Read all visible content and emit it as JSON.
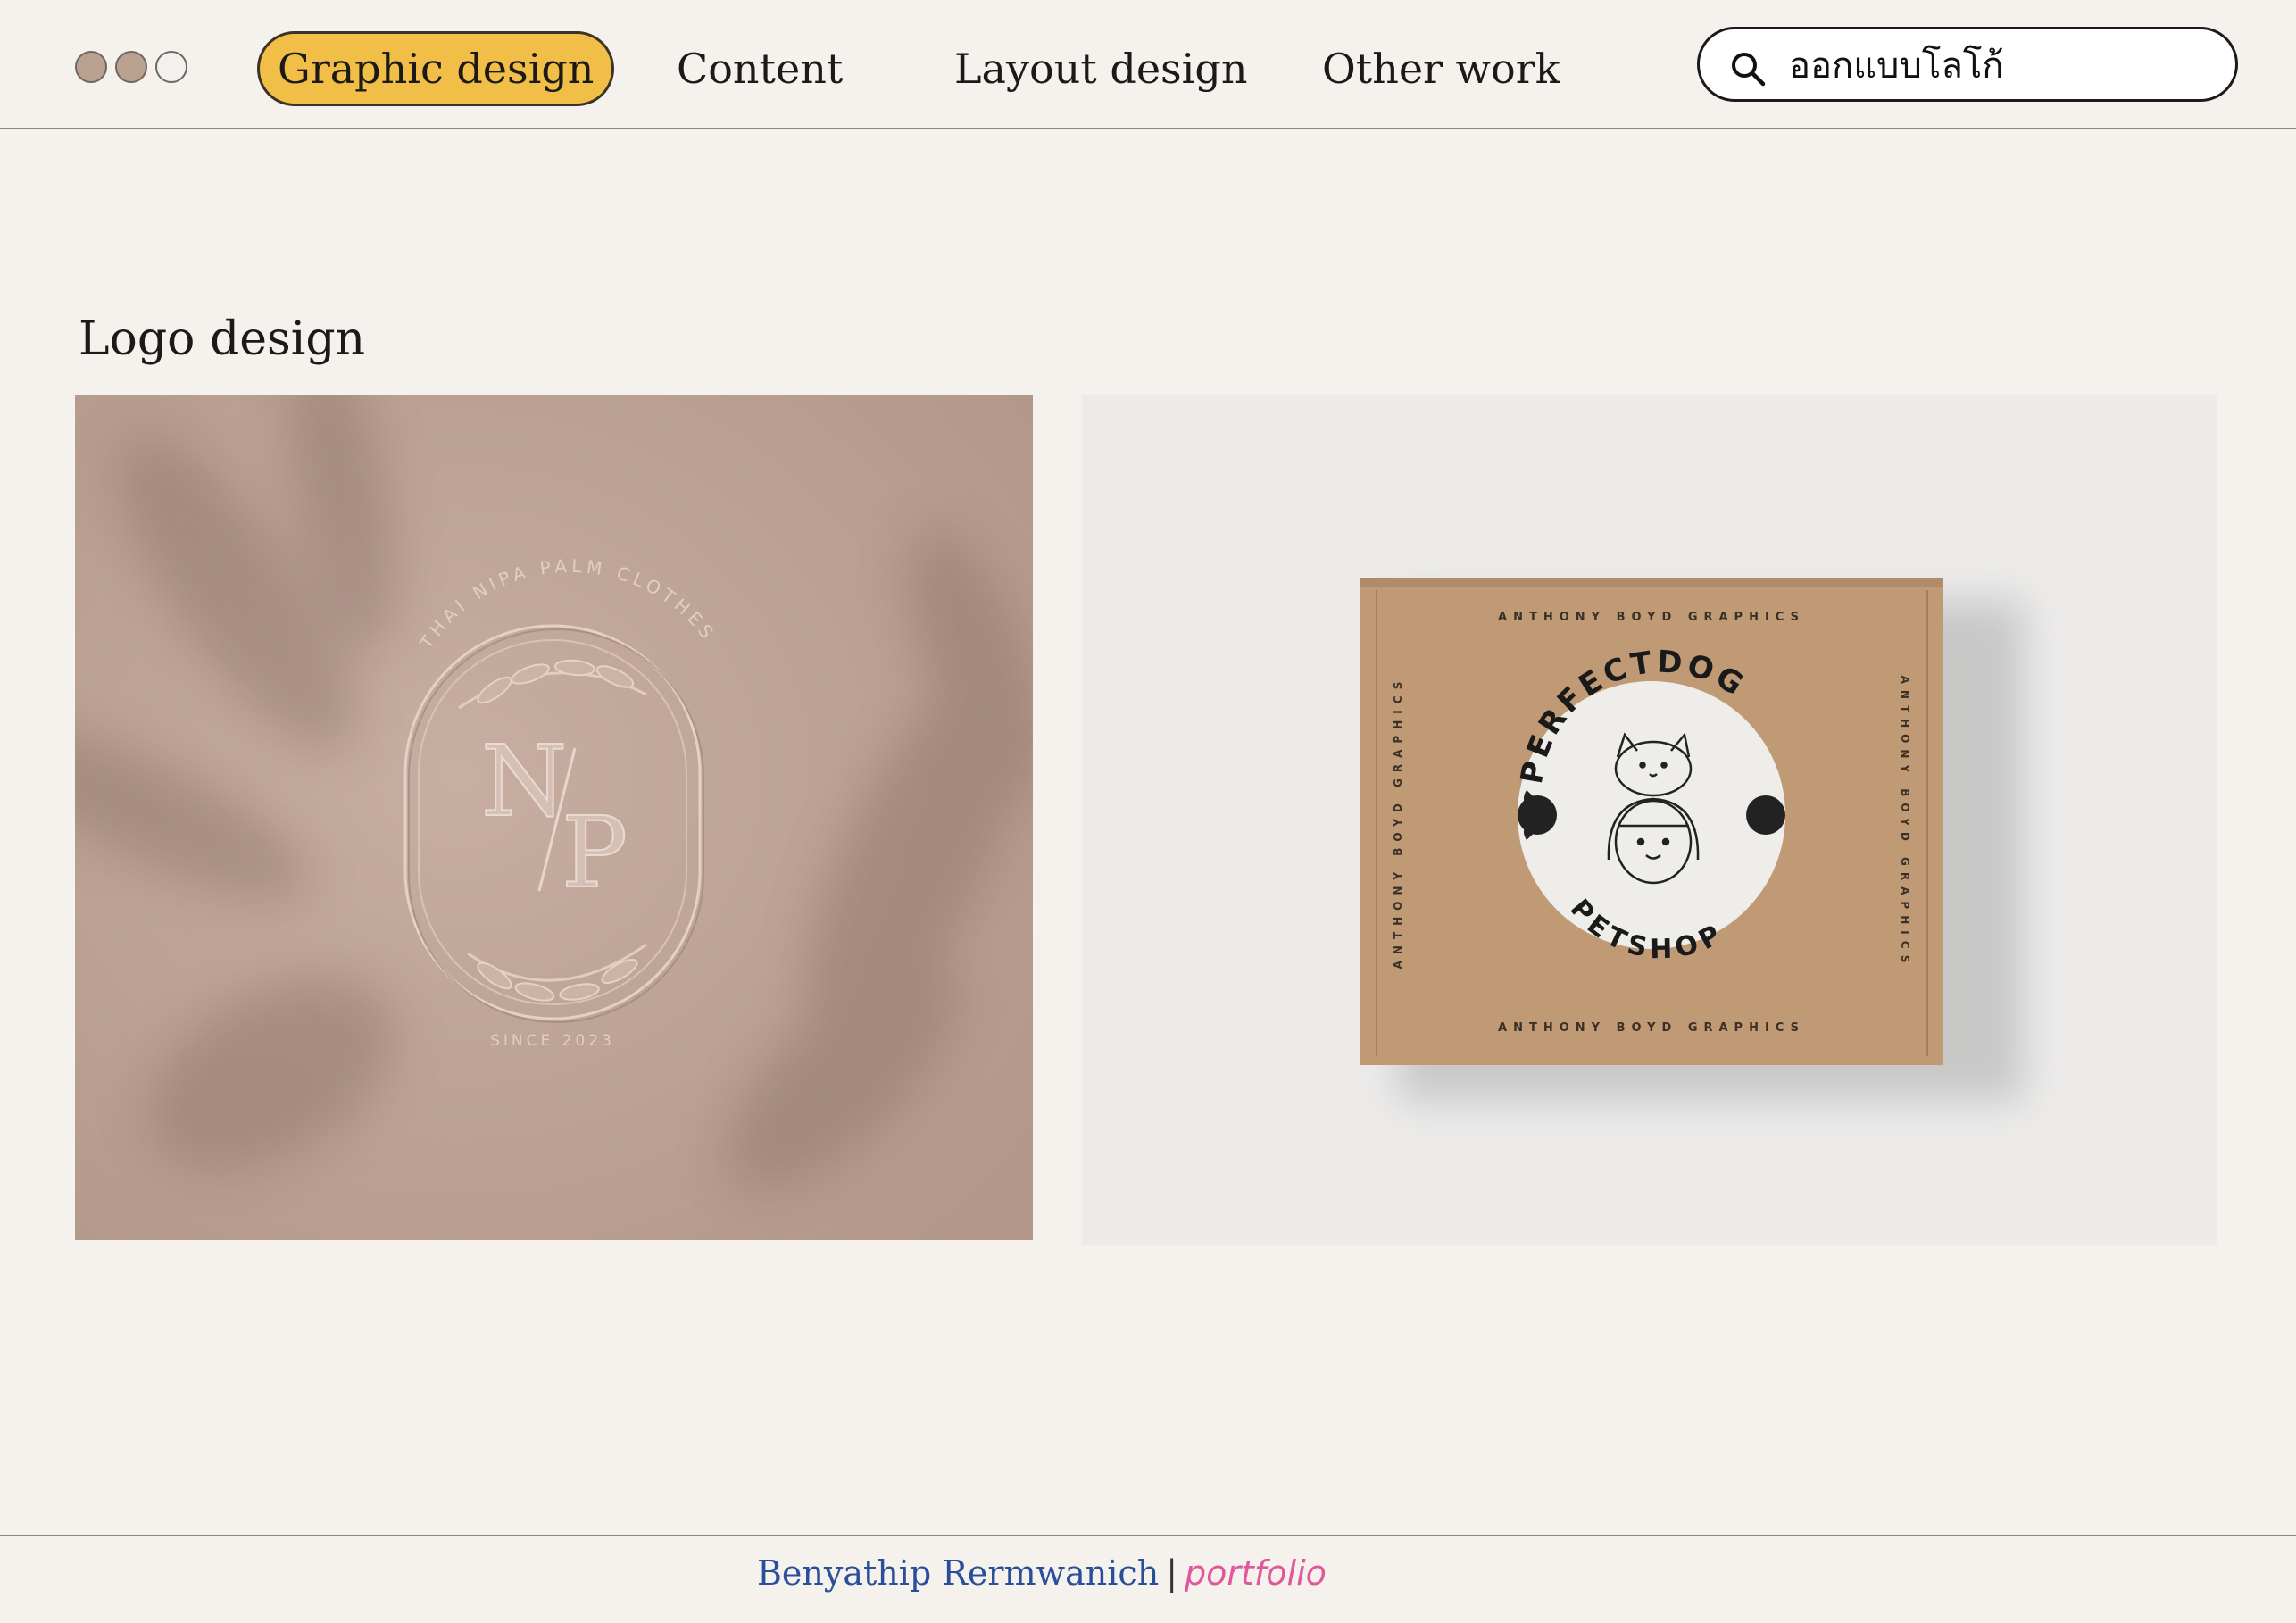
{
  "window": {
    "controls": [
      {
        "name": "window-dot-1",
        "color": "#b9a08f"
      },
      {
        "name": "window-dot-2",
        "color": "#b9a08f"
      },
      {
        "name": "window-dot-3",
        "color": "#f3f1ee"
      }
    ]
  },
  "nav": {
    "items": [
      {
        "label": "Graphic design",
        "active": true
      },
      {
        "label": "Content",
        "active": false
      },
      {
        "label": "Layout design",
        "active": false
      },
      {
        "label": "Other work",
        "active": false
      }
    ],
    "active_color": "#f1bf47"
  },
  "search": {
    "icon": "search-icon",
    "value": "ออกแบบโลโก้"
  },
  "main": {
    "section_title": "Logo design",
    "images": [
      {
        "name": "np-embossed-logo",
        "monogram_n": "N",
        "monogram_p": "P",
        "arc_text": "THAI NIPA PALM CLOTHES",
        "since_text": "SINCE 2023"
      },
      {
        "name": "perfectdog-box-mockup",
        "top_text": "PERFECTDOG",
        "bottom_text": "PETSHOP",
        "box_text": "ANTHONY BOYD GRAPHICS"
      }
    ]
  },
  "footer": {
    "name": "Benyathip Rermwanich",
    "separator": "|",
    "tag": "portfolio"
  }
}
